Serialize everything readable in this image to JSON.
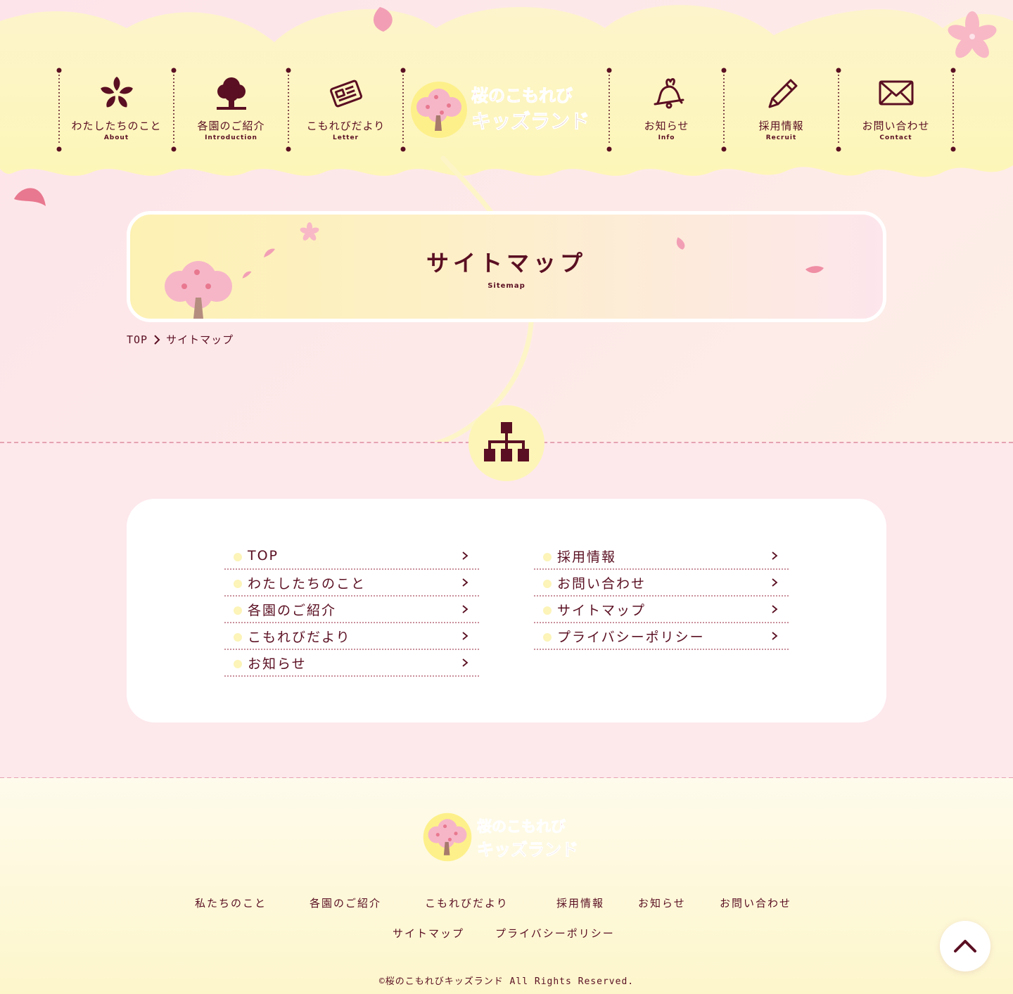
{
  "colors": {
    "brand": "#5a0f22",
    "pink_bg": "#fde8ec",
    "yellow": "#fdf5b8",
    "accent_pink": "#f29fb5"
  },
  "header": {
    "logo_line1": "桜のこもれび",
    "logo_line2": "キッズランド",
    "nav_left": [
      {
        "label": "わたしたちのこと",
        "sub": "About",
        "icon": "sakura-icon"
      },
      {
        "label": "各園のご紹介",
        "sub": "Introduction",
        "icon": "tree-icon"
      },
      {
        "label": "こもれびだより",
        "sub": "Letter",
        "icon": "newspaper-icon"
      }
    ],
    "nav_right": [
      {
        "label": "お知らせ",
        "sub": "Info",
        "icon": "bell-icon"
      },
      {
        "label": "採用情報",
        "sub": "Recruit",
        "icon": "pencil-icon"
      },
      {
        "label": "お問い合わせ",
        "sub": "Contact",
        "icon": "envelope-icon"
      }
    ]
  },
  "hero": {
    "title": "サイトマップ",
    "subtitle": "Sitemap"
  },
  "breadcrumb": {
    "home": "TOP",
    "current": "サイトマップ"
  },
  "sitemap": {
    "icon": "sitemap-icon",
    "left": [
      "TOP",
      "わたしたちのこと",
      "各園のご紹介",
      "こもれびだより",
      "お知らせ"
    ],
    "right": [
      "採用情報",
      "お問い合わせ",
      "サイトマップ",
      "プライバシーポリシー"
    ]
  },
  "footer": {
    "logo_line1": "桜のこもれび",
    "logo_line2": "キッズランド",
    "nav_row1": [
      "私たちのこと",
      "各園のご紹介",
      "こもれびだより",
      "採用情報",
      "お知らせ",
      "お問い合わせ"
    ],
    "nav_row2": [
      "サイトマップ",
      "プライバシーポリシー"
    ],
    "copyright": "©桜のこもれびキッズランド All Rights Reserved."
  }
}
